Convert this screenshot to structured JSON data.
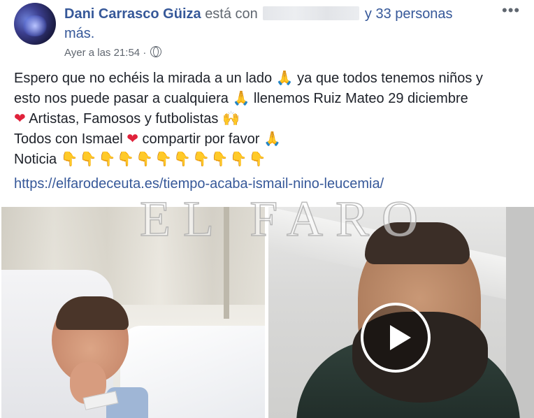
{
  "post": {
    "author": "Dani Carrasco Güiza",
    "with_text": "está con",
    "tag_suffix": "y 33 personas",
    "tag_suffix_line2": "más.",
    "timestamp": "Ayer a las 21:54",
    "separator": "·",
    "privacy_icon": "globe-icon",
    "more_label": "•••",
    "body": {
      "line1_a": "Espero que no echéis la mirada a un lado",
      "line1_b": "ya que todos tenemos niños y",
      "line2_a": "esto nos puede pasar a cualquiera",
      "line2_b": "llenemos Ruiz Mateo 29 diciembre",
      "line3": "Artistas, Famosos y futbolistas",
      "line4_a": "Todos con Ismael",
      "line4_b": "compartir por favor",
      "line5": "Noticia"
    },
    "emoji": {
      "pray": "🙏",
      "heart": "❤",
      "raised_hands": "🙌",
      "point_down": "👇👇👇👇👇👇👇👇👇👇👇"
    },
    "link_url": "https://elfarodeceuta.es/tiempo-acaba-ismail-nino-leucemia/",
    "watermark": "EL FARO"
  }
}
